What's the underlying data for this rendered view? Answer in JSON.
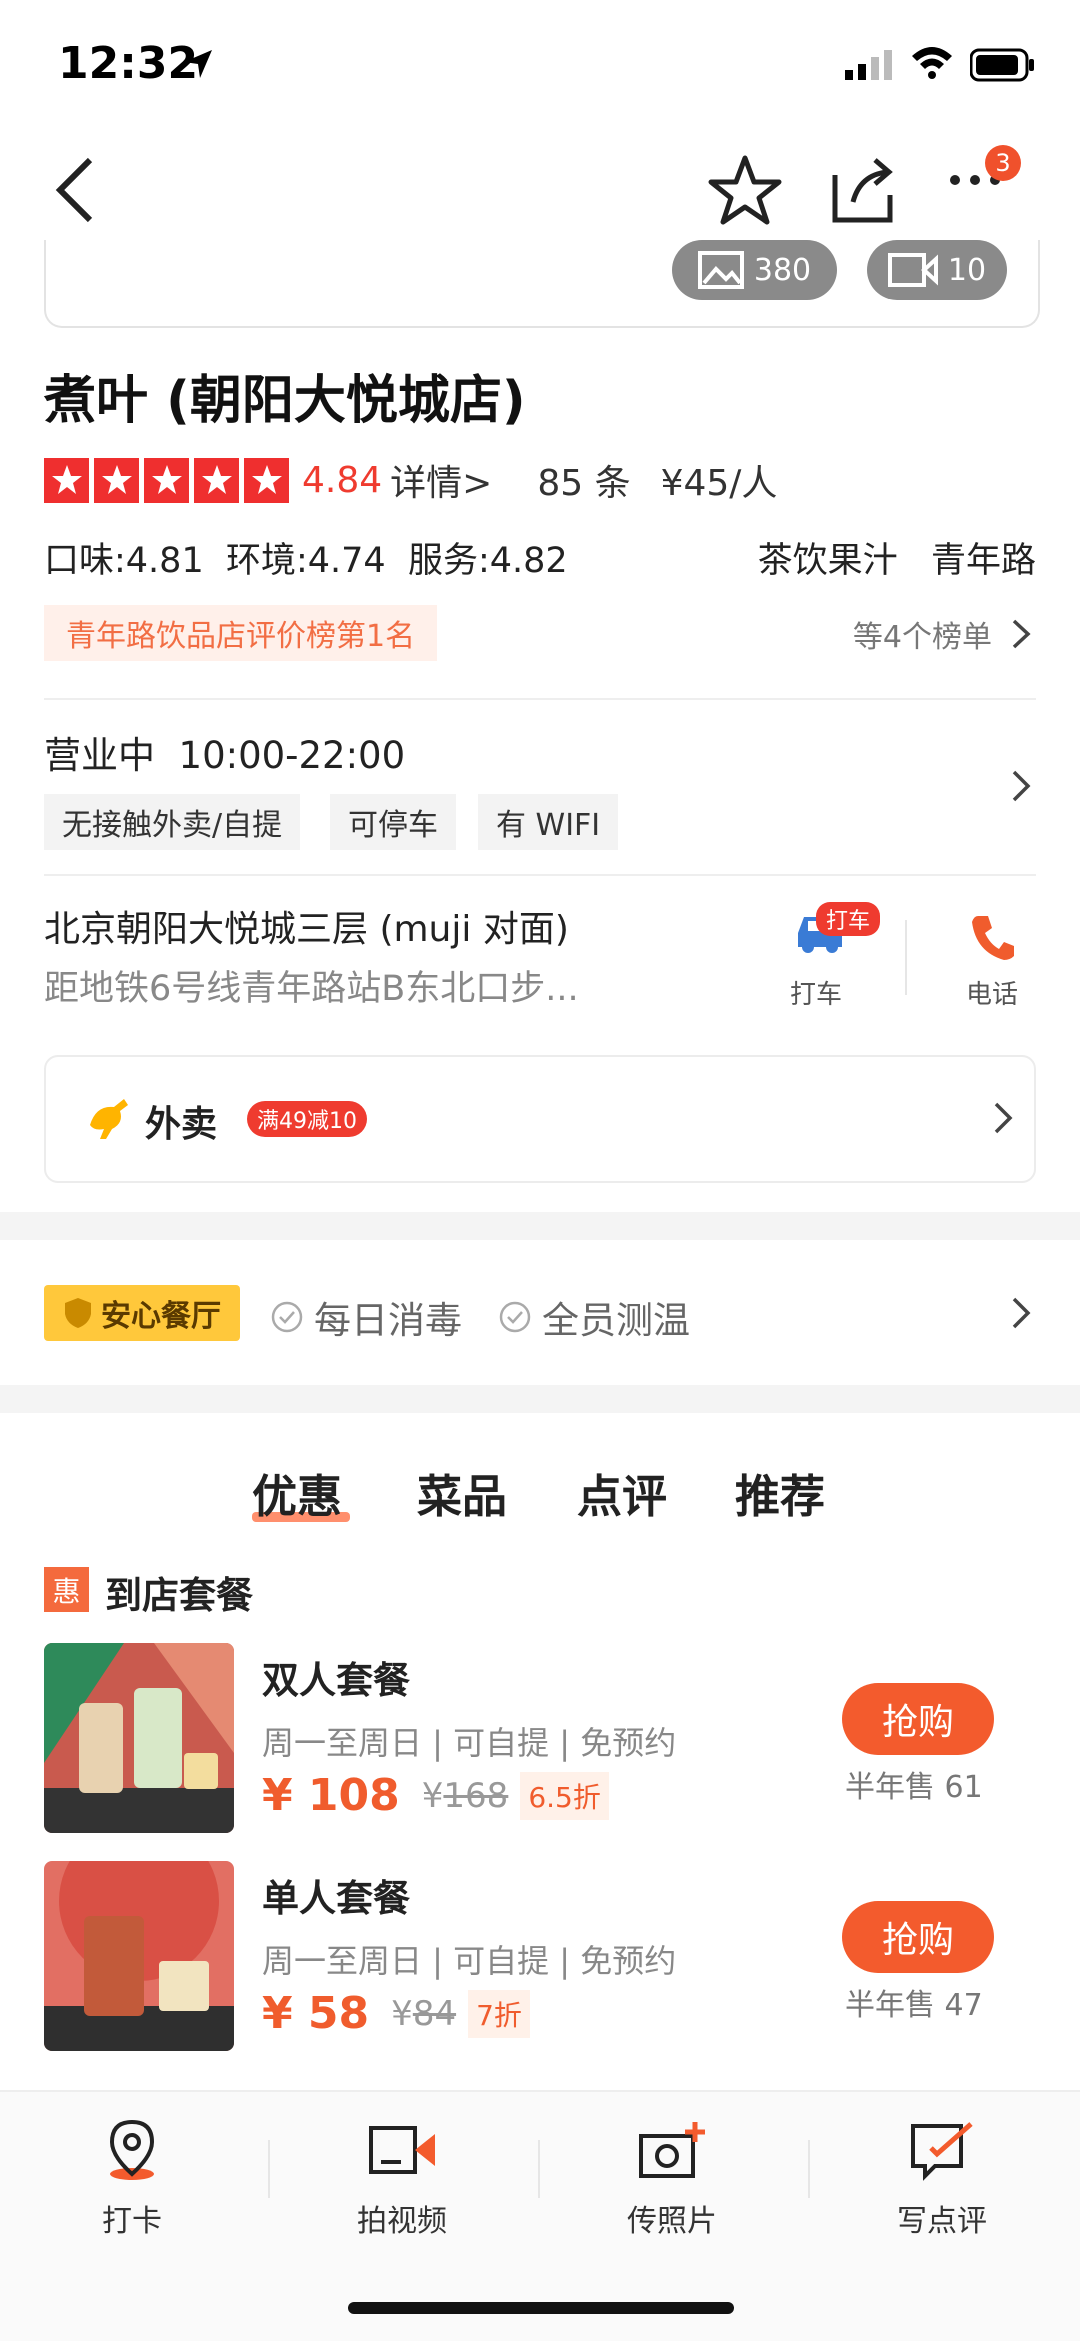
{
  "status_bar": {
    "time": "12:32"
  },
  "nav": {
    "more_badge": "3"
  },
  "gallery": {
    "photo_count": "380",
    "video_count": "10"
  },
  "shop": {
    "name": "煮叶 (朝阳大悦城店)",
    "rating": "4.84",
    "rating_detail": "详情>",
    "review_count": "85 条",
    "avg_price": "¥45/人",
    "scores": "口味:4.81  环境:4.74  服务:4.82",
    "category": "茶饮果汁   青年路",
    "rank_tag": "青年路饮品店评价榜第1名",
    "rank_more": "等4个榜单"
  },
  "business": {
    "hours": "营业中  10:00-22:00",
    "tags": [
      "无接触外卖/自提",
      "可停车",
      "有 WIFI"
    ]
  },
  "location": {
    "address": "北京朝阳大悦城三层 (muji 对面)",
    "address_sub": "距地铁6号线青年路站B东北口步...",
    "taxi_badge": "打车",
    "taxi_label": "打车",
    "phone_label": "电话"
  },
  "delivery": {
    "title": "外卖",
    "badge": "满49减10"
  },
  "safety": {
    "badge": "安心餐厅",
    "items": [
      "每日消毒",
      "全员测温"
    ]
  },
  "tabs": [
    "优惠",
    "菜品",
    "点评",
    "推荐"
  ],
  "coupon_section": {
    "icon": "惠",
    "title": "到店套餐"
  },
  "deals": [
    {
      "title": "双人套餐",
      "meta": "周一至周日 | 可自提 | 免预约",
      "price": "¥ 108",
      "old_price_prefix": "¥",
      "old_price": "168",
      "discount": "6.5折",
      "buy": "抢购",
      "sold": "半年售 61"
    },
    {
      "title": "单人套餐",
      "meta": "周一至周日 | 可自提 | 免预约",
      "price": "¥ 58",
      "old_price_prefix": "¥",
      "old_price": "84",
      "discount": "7折",
      "buy": "抢购",
      "sold": "半年售 47"
    }
  ],
  "bottom_bar": [
    {
      "label": "打卡",
      "icon": "location-pin-icon"
    },
    {
      "label": "拍视频",
      "icon": "video-camera-icon"
    },
    {
      "label": "传照片",
      "icon": "camera-add-icon"
    },
    {
      "label": "写点评",
      "icon": "write-review-icon"
    }
  ],
  "colors": {
    "accent": "#f35b2d",
    "star": "#ef2f2f",
    "gold": "#ffc83b"
  }
}
